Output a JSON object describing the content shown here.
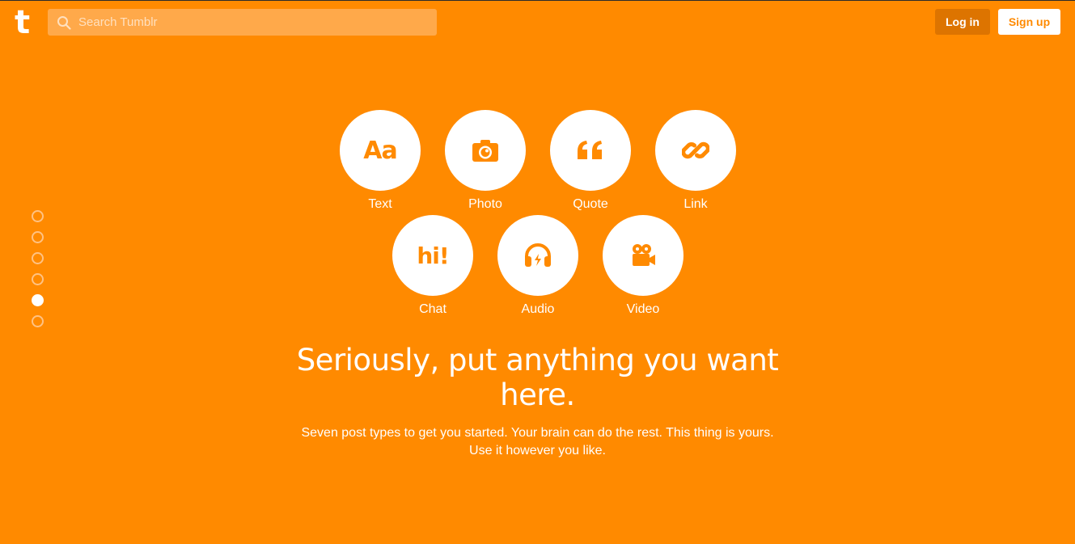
{
  "header": {
    "logo_text": "t",
    "search_placeholder": "Search Tumblr",
    "login_label": "Log in",
    "signup_label": "Sign up"
  },
  "pager": {
    "count": 6,
    "active_index": 4
  },
  "post_types": [
    {
      "label": "Text",
      "icon": "text-aa-icon",
      "glyph": "Aa"
    },
    {
      "label": "Photo",
      "icon": "camera-icon"
    },
    {
      "label": "Quote",
      "icon": "quote-marks-icon",
      "glyph": "“"
    },
    {
      "label": "Link",
      "icon": "link-icon"
    },
    {
      "label": "Chat",
      "icon": "chat-hi-icon",
      "glyph": "hi!"
    },
    {
      "label": "Audio",
      "icon": "headphones-icon"
    },
    {
      "label": "Video",
      "icon": "video-camera-icon"
    }
  ],
  "main": {
    "headline": "Seriously, put anything you want here.",
    "subtext": "Seven post types to get you started. Your brain can do the rest. This thing is yours. Use it however you like."
  },
  "colors": {
    "background": "#ff8a00",
    "accent": "#ffffff",
    "login_bg": "#dd7400"
  }
}
